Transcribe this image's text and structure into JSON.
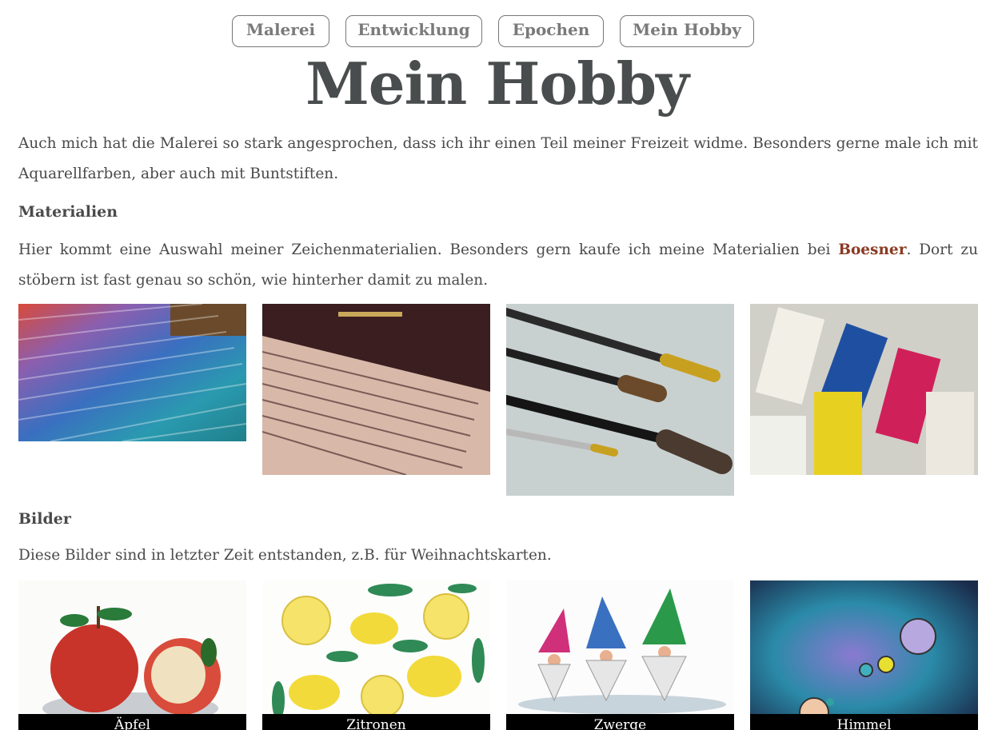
{
  "nav": {
    "items": [
      "Malerei",
      "Entwicklung",
      "Epochen",
      "Mein Hobby"
    ]
  },
  "page": {
    "title": "Mein Hobby"
  },
  "intro": {
    "text": "Auch mich hat die Malerei so stark angesprochen, dass ich ihr einen Teil meiner Freizeit widme. Besonders gerne male ich mit Aquarellfarben, aber auch mit Buntstiften."
  },
  "materials": {
    "heading": "Materialien",
    "text_before": "Hier kommt eine Auswahl meiner Zeichenmaterialien. Besonders gern kaufe ich meine Materialien bei ",
    "link_label": "Boesner",
    "text_after": ". Dort zu stöbern ist fast genau so schön, wie hinterher damit zu malen.",
    "photos": [
      "colored-pencils-photo",
      "pastel-pencils-photo",
      "brushes-photo",
      "gouache-tubes-photo"
    ]
  },
  "gallery": {
    "heading": "Bilder",
    "text": "Diese Bilder sind in letzter Zeit entstanden, z.B. für Weihnachtskarten.",
    "items": [
      {
        "caption": "Äpfel"
      },
      {
        "caption": "Zitronen"
      },
      {
        "caption": "Zwerge"
      },
      {
        "caption": "Himmel"
      }
    ]
  },
  "colors": {
    "text": "#4a4a4a",
    "link": "#8a3a22",
    "caption_bg": "#000000"
  }
}
